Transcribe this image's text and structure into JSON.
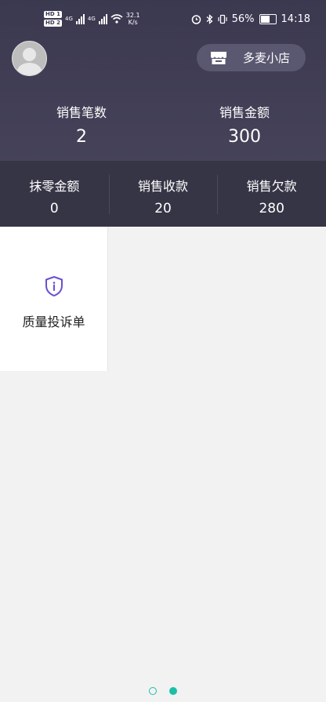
{
  "statusbar": {
    "hd1": "HD 1",
    "hd2": "HD 2",
    "net_type_1": "4G",
    "net_type_2": "4G",
    "speed_value": "32.1",
    "speed_unit": "K/s",
    "battery_percent": "56%",
    "time": "14:18"
  },
  "header": {
    "store_name": "多麦小店"
  },
  "stats": [
    {
      "label": "销售笔数",
      "value": "2"
    },
    {
      "label": "销售金额",
      "value": "300"
    }
  ],
  "band": [
    {
      "label": "抹零金额",
      "value": "0"
    },
    {
      "label": "销售收款",
      "value": "20"
    },
    {
      "label": "销售欠款",
      "value": "280"
    }
  ],
  "grid": {
    "items": [
      {
        "label": "质量投诉单",
        "icon": "shield-info-icon"
      }
    ]
  },
  "pager": {
    "count": 2,
    "active": 1
  },
  "colors": {
    "header_bg": "#3b3950",
    "accent": "#1bbfa8",
    "icon": "#6a4fd0"
  }
}
